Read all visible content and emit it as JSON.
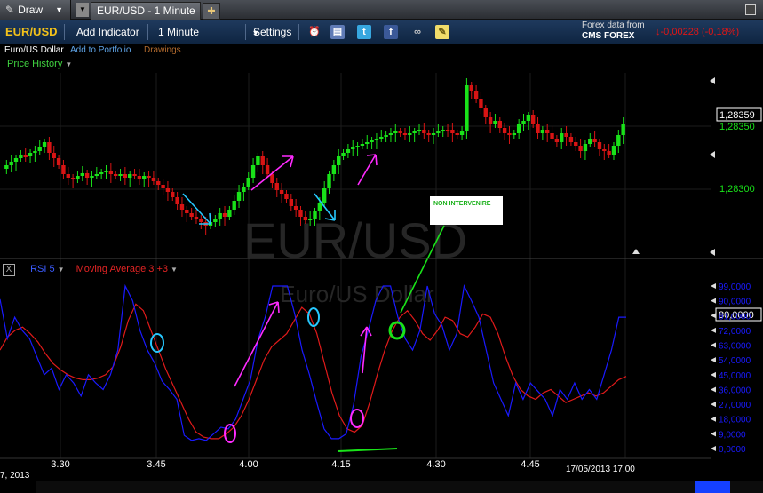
{
  "topbar": {
    "draw_label": "Draw",
    "tab_title": "EUR/USD - 1 Minute"
  },
  "toolbar": {
    "symbol": "EUR/USD",
    "add_indicator": "Add Indicator",
    "timeframe": "1 Minute",
    "settings": "Settings",
    "forex_data_from": "Forex data from",
    "forex_brand": "CMS FOREX",
    "price_change": "-0,00228 (-0,18%)",
    "icons": [
      "alarm-clock-icon",
      "layers-icon",
      "twitter-icon",
      "facebook-icon",
      "binoculars-icon",
      "note-icon"
    ]
  },
  "subheader": {
    "pair_name": "Euro/US Dollar",
    "add_to_portfolio": "Add to Portfolio",
    "drawings": "Drawings",
    "price_history": "Price History"
  },
  "watermark": {
    "symbol": "EUR/USD",
    "name": "Euro/US Dollar"
  },
  "annotation_note": "NON INTERVENIRE",
  "price_axis": {
    "current_price": "1,28359",
    "labels": [
      "1,28350",
      "1,28300"
    ]
  },
  "rsi_panel": {
    "close_label": "X",
    "rsi_label": "RSI 5",
    "ma_label": "Moving Average 3 +3",
    "current_value": "80,0000",
    "axis_labels": [
      "99,0000",
      "90,0000",
      "81,0000",
      "72,0000",
      "63,0000",
      "54,0000",
      "45,0000",
      "36,0000",
      "27,0000",
      "18,0000",
      "9,0000",
      "0,0000"
    ]
  },
  "time_axis": {
    "labels": [
      "3.30",
      "3.45",
      "4.00",
      "4.15",
      "4.30",
      "4.45"
    ],
    "cursor_time": "17/05/2013 17.00",
    "left_date": "7, 2013"
  },
  "colors": {
    "bull": "#19e219",
    "bear": "#d81414",
    "rsi": "#1a1aff",
    "ma": "#e01a1a",
    "magenta": "#ff2bff",
    "cyan": "#27c8ff",
    "accent_yellow": "#f3c21a"
  },
  "chart_data": [
    {
      "type": "candlestick",
      "title": "Price History",
      "x_tick_labels": [
        "3.30",
        "3.45",
        "4.00",
        "4.15",
        "4.30",
        "4.45"
      ],
      "y_labels": [
        "1,28350",
        "1,28300"
      ],
      "last_price": 1.28359,
      "ylim": [
        1.2824,
        1.284
      ]
    },
    {
      "type": "line",
      "series": [
        {
          "name": "RSI 5",
          "values": [
            91,
            67,
            80,
            72,
            67,
            56,
            45,
            49,
            36,
            45,
            40,
            32,
            45,
            40,
            36,
            45,
            60,
            99,
            90,
            72,
            60,
            52,
            41,
            36,
            30,
            8,
            5,
            6,
            5,
            9,
            13,
            12,
            18,
            30,
            42,
            66,
            80,
            99,
            99,
            99,
            82,
            60,
            45,
            28,
            12,
            6,
            6,
            9,
            27,
            56,
            72,
            90,
            99,
            99,
            80,
            67,
            60,
            72,
            99,
            82,
            75,
            60,
            70,
            99,
            90,
            80,
            60,
            40,
            30,
            20,
            40,
            30,
            40,
            35,
            30,
            20,
            36,
            30,
            40,
            30,
            36,
            30,
            45,
            60,
            80,
            80
          ]
        },
        {
          "name": "Moving Average 3 +3",
          "values": [
            60,
            68,
            72,
            74,
            70,
            65,
            58,
            52,
            48,
            45,
            43,
            42,
            42,
            43,
            45,
            50,
            62,
            78,
            88,
            84,
            72,
            60,
            48,
            38,
            28,
            18,
            10,
            7,
            6,
            6,
            9,
            13,
            20,
            30,
            42,
            54,
            62,
            66,
            70,
            78,
            86,
            82,
            70,
            52,
            34,
            20,
            12,
            10,
            14,
            28,
            45,
            60,
            72,
            80,
            84,
            78,
            70,
            66,
            72,
            80,
            78,
            70,
            68,
            74,
            82,
            80,
            70,
            56,
            44,
            36,
            32,
            30,
            34,
            36,
            32,
            28,
            30,
            32,
            34,
            32,
            34,
            38,
            42,
            44
          ]
        }
      ],
      "axis_labels": [
        "99,0000",
        "90,0000",
        "81,0000",
        "72,0000",
        "63,0000",
        "54,0000",
        "45,0000",
        "36,0000",
        "27,0000",
        "18,0000",
        "9,0000",
        "0,0000"
      ],
      "ylim": [
        0,
        99
      ]
    }
  ]
}
